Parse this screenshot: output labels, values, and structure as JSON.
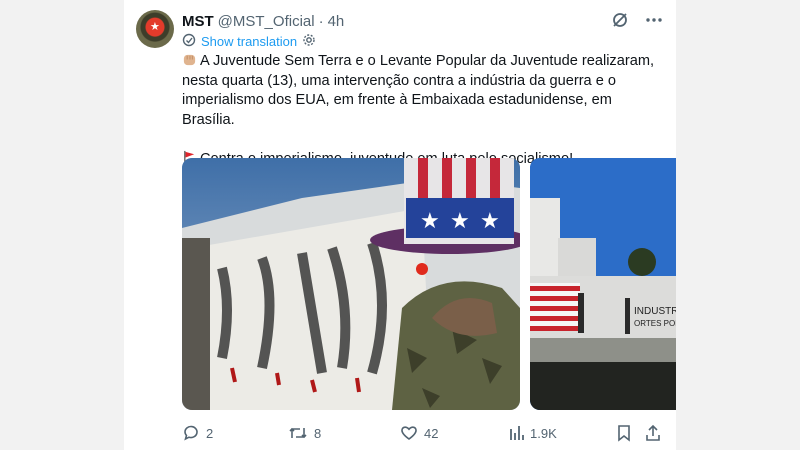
{
  "tweet": {
    "name": "MST",
    "handle": "@MST_Oficial",
    "separator": "·",
    "time": "4h",
    "show_translation": "Show translation",
    "line1": "A Juventude Sem Terra e o Levante Popular da Juventude realizaram,",
    "line2": "nesta quarta (13), uma intervenção contra a indústria da guerra e o",
    "line3": "imperialismo dos EUA, em frente à Embaixada estadunidense, em Brasília.",
    "line4": "Contra o imperialismo, juventude em luta pelo socialismo!"
  },
  "icons": {
    "grok": "grok-icon",
    "more": "more-icon",
    "translate": "translate-icon",
    "settings": "gear-icon",
    "fist": "raised-fist-emoji",
    "flag": "red-flag-emoji",
    "reply": "reply-icon",
    "retweet": "retweet-icon",
    "like": "heart-icon",
    "views": "views-icon",
    "bookmark": "bookmark-icon",
    "share": "share-icon"
  },
  "media": {
    "image2_sign": "INDUSTR",
    "image2_sign2": "ORTES POR"
  },
  "actions": {
    "replies": "2",
    "retweets": "8",
    "likes": "42",
    "views": "1.9K"
  },
  "colors": {
    "accent": "#1d9bf0",
    "muted": "#536471"
  }
}
